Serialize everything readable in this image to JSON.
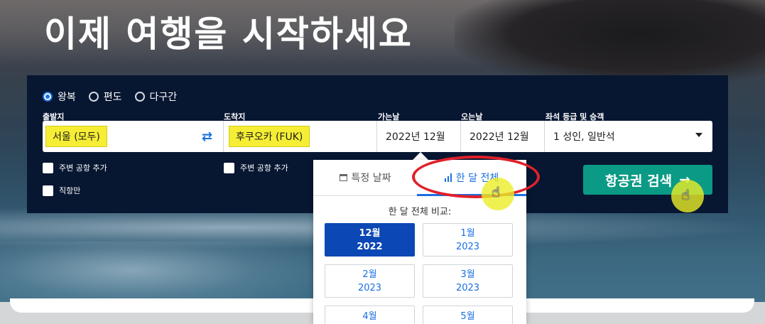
{
  "hero": {
    "title": "이제 여행을 시작하세요"
  },
  "trip_type": {
    "options": [
      {
        "label": "왕복",
        "selected": true
      },
      {
        "label": "편도",
        "selected": false
      },
      {
        "label": "다구간",
        "selected": false
      }
    ]
  },
  "fields": {
    "origin": {
      "label": "출발지",
      "value": "서울 (모두)"
    },
    "destination": {
      "label": "도착지",
      "value": "후쿠오카 (FUK)"
    },
    "depart": {
      "label": "가는날",
      "value": "2022년 12월"
    },
    "return": {
      "label": "오는날",
      "value": "2022년 12월"
    },
    "cabin": {
      "label": "좌석 등급 및 승객",
      "value": "1 성인, 일반석"
    }
  },
  "checkboxes": {
    "origin_nearby": "주변 공항 추가",
    "dest_nearby": "주변 공항 추가",
    "direct_only": "직항만"
  },
  "search_button": {
    "label": "항공권 검색",
    "arrow": "→"
  },
  "date_dropdown": {
    "tabs": [
      {
        "label": "특정 날짜",
        "icon": "calendar-icon",
        "active": false
      },
      {
        "label": "한 달 전체",
        "icon": "bar-chart-icon",
        "active": true
      }
    ],
    "compare_label": "한 달 전체 비교:",
    "months": [
      {
        "month": "12월",
        "year": "2022",
        "selected": true
      },
      {
        "month": "1월",
        "year": "2023",
        "selected": false
      },
      {
        "month": "2월",
        "year": "2023",
        "selected": false
      },
      {
        "month": "3월",
        "year": "2023",
        "selected": false
      },
      {
        "month": "4월",
        "year": "",
        "selected": false
      },
      {
        "month": "5월",
        "year": "",
        "selected": false
      }
    ]
  },
  "colors": {
    "panel_bg": "#071631",
    "accent_blue": "#1a6fe0",
    "selected_month": "#0b47b5",
    "search_button": "#0b9a85",
    "highlight_yellow": "#f6ee34",
    "annotation_red": "#e0202a"
  }
}
